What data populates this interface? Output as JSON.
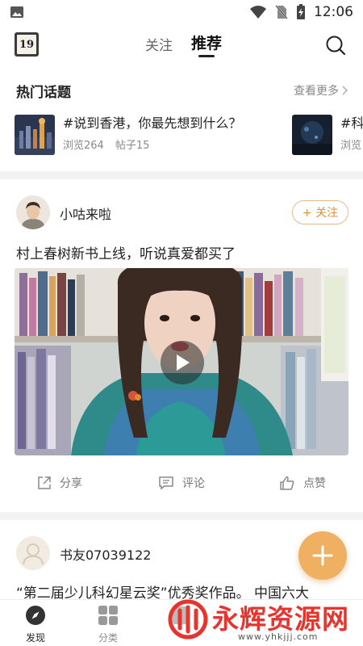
{
  "status_bar": {
    "time": "12:06"
  },
  "top_nav": {
    "logo_text": "19",
    "tabs": [
      {
        "label": "关注",
        "active": false
      },
      {
        "label": "推荐",
        "active": true
      }
    ]
  },
  "hot_topics": {
    "title": "热门话题",
    "more_label": "查看更多",
    "items": [
      {
        "name": "#说到香港，你最先想到什么？",
        "views": "浏览264",
        "posts": "帖子15"
      },
      {
        "name": "#科",
        "views": "浏览",
        "posts": ""
      }
    ]
  },
  "posts": [
    {
      "username": "小咕来啦",
      "follow_label": "+ 关注",
      "text": "村上春树新书上线，听说真爱都买了",
      "actions": {
        "share": "分享",
        "comment": "评论",
        "like": "点赞"
      }
    },
    {
      "username": "书友07039122",
      "text": "“第二届少儿科幻星云奖”优秀奖作品。 中国六大"
    }
  ],
  "bottom_nav": [
    {
      "label": "发现",
      "active": true
    },
    {
      "label": "分类",
      "active": false
    },
    {
      "label": "",
      "active": false
    }
  ],
  "watermark": {
    "text": "永辉资源网",
    "url": "www.yhkjjj.com"
  },
  "colors": {
    "accent": "#f0b062",
    "follow_border": "#e7b98a",
    "watermark_red": "#e8342f"
  }
}
